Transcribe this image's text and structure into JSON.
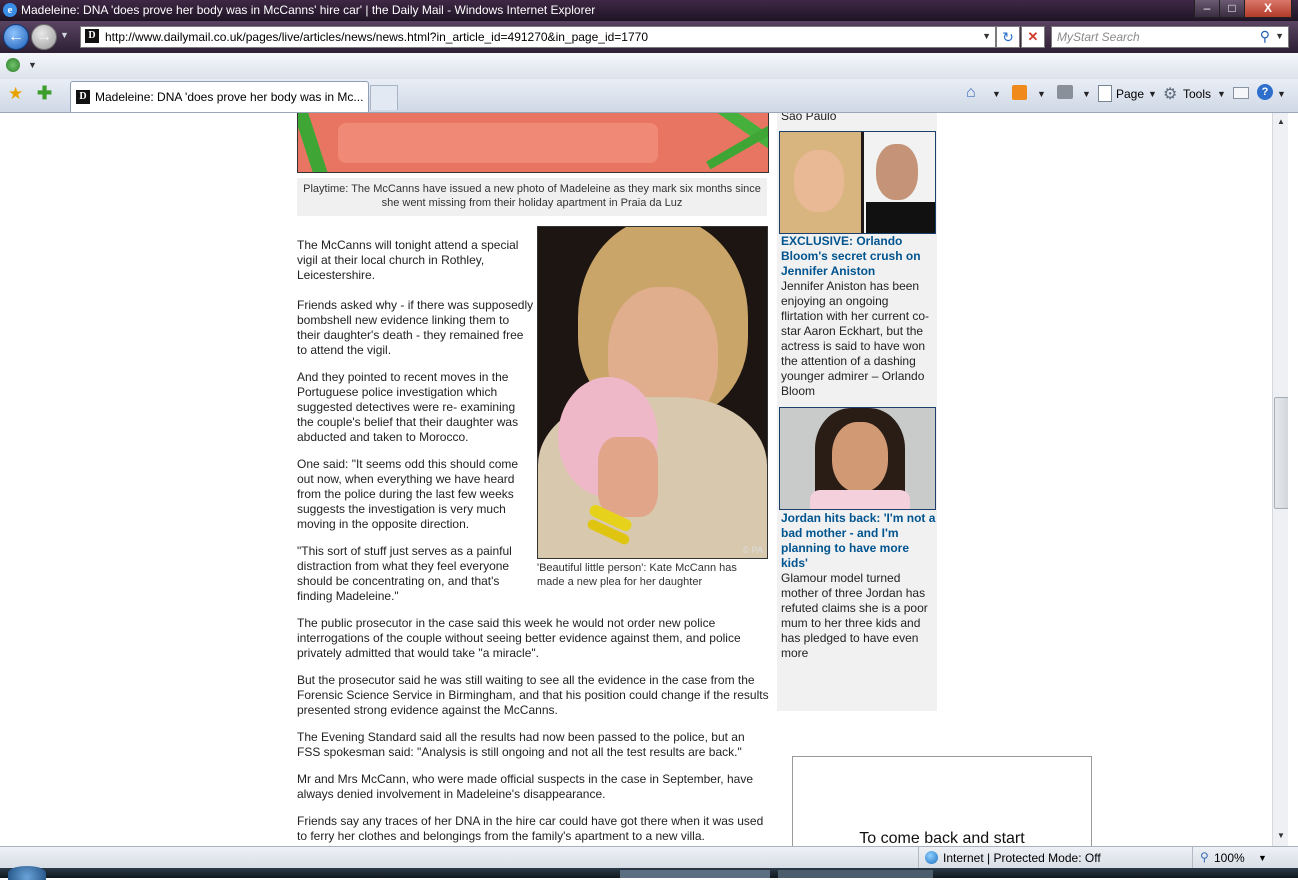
{
  "window": {
    "title": "Madeleine: DNA 'does prove her body was in McCanns' hire car' | the Daily Mail - Windows Internet Explorer",
    "minimize_glyph": "–",
    "maximize_glyph": "□",
    "close_glyph": "X"
  },
  "toolbar": {
    "back_glyph": "←",
    "forward_glyph": "→",
    "url": "http://www.dailymail.co.uk/pages/live/articles/news/news.html?in_article_id=491270&in_page_id=1770",
    "search_placeholder": "MyStart Search",
    "dropdown_glyph": "▼",
    "refresh_glyph": "↻",
    "stop_glyph": "✕",
    "search_glyph": "⚲",
    "site_favicon": "D"
  },
  "tabs": {
    "active_label": "Madeleine: DNA 'does prove her body was in Mc...",
    "commands": {
      "page_label": "Page",
      "tools_label": "Tools",
      "help_glyph": "?"
    }
  },
  "article": {
    "top_caption": "Playtime: The McCanns have issued a new photo of Madeleine as they mark six months since she went missing from their holiday apartment in Praia da Luz",
    "photo_credit": "© PA",
    "photo_caption": "'Beautiful little person': Kate McCann has made a new plea for her daughter",
    "paragraphs": [
      "The McCanns will tonight attend a special vigil at their local church in Rothley, Leicestershire.",
      "Friends asked why - if there was supposedly bombshell new evidence linking them to their daughter's death - they remained free to attend the vigil.",
      "And they pointed to recent moves in the Portuguese police investigation which suggested detectives were re- examining the couple's belief that their daughter was abducted and taken to Morocco.",
      "One said: \"It seems odd this should come out now, when everything we have heard from the police during the last few weeks suggests the investigation is very much moving in the opposite direction.",
      "\"This sort of stuff just serves as a painful distraction from what they feel everyone should be concentrating on, and that's finding Madeleine.\"",
      "The public prosecutor in the case said this week he would not order new police interrogations of the couple without seeing better evidence against them, and police privately admitted that would take \"a miracle\".",
      "But the prosecutor said he was still waiting to see all the evidence in the case from the Forensic Science Service in Birmingham, and that his position could change if the results presented strong evidence against the McCanns.",
      "The Evening Standard said all the results had now been passed to the police, but an FSS spokesman said: \"Analysis is still ongoing and not all the test results are back.\"",
      "Mr and Mrs McCann, who were made official suspects in the case in September, have always denied involvement in Madeleine's disappearance.",
      "Friends say any traces of her DNA in the hire car could have got there when it was used to ferry her clothes and belongings from the family's apartment to a new villa."
    ]
  },
  "sidebar": {
    "top_fragment": "Sao Paulo",
    "stories": [
      {
        "headline": "EXCLUSIVE: Orlando Bloom's secret crush on Jennifer Aniston",
        "body": "Jennifer Aniston has been enjoying an ongoing flirtation with her current co-star Aaron Eckhart, but the actress is said to have won the attention of a dashing younger admirer – Orlando Bloom"
      },
      {
        "headline": "Jordan hits back: 'I'm not a bad mother - and I'm planning to have more kids'",
        "body": "Glamour model turned mother of three Jordan has refuted claims she is a poor mum to her three kids and has pledged to have even more"
      }
    ],
    "ad_text": "To come back and start"
  },
  "status": {
    "zone": "Internet | Protected Mode: Off",
    "zoom": "100%"
  },
  "colors": {
    "titlebar": "#2a1c30",
    "link_blue": "#00548f",
    "sidebar_bg": "#f1f1f1"
  }
}
